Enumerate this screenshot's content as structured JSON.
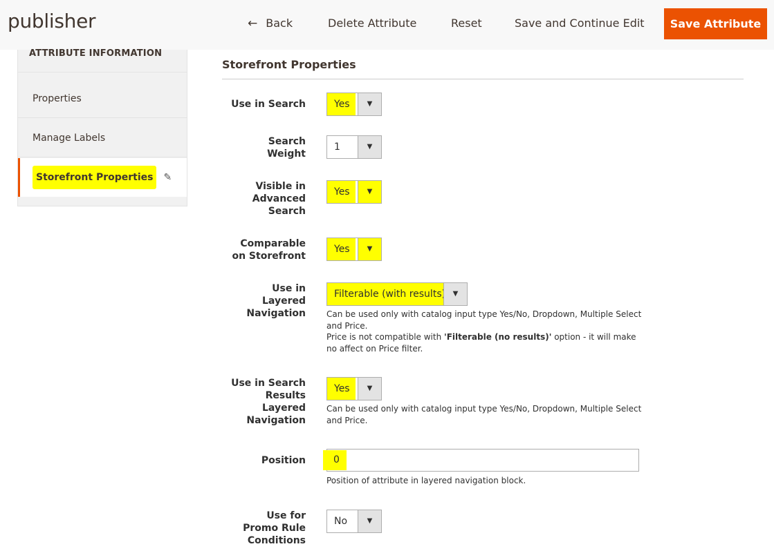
{
  "header": {
    "title": "publisher",
    "back_label": "Back",
    "delete_label": "Delete Attribute",
    "reset_label": "Reset",
    "save_continue_label": "Save and Continue Edit",
    "save_label": "Save Attribute",
    "accent_color": "#eb5202"
  },
  "sidebar": {
    "heading": "ATTRIBUTE INFORMATION",
    "items": [
      {
        "label": "Properties"
      },
      {
        "label": "Manage Labels"
      },
      {
        "label": "Storefront Properties"
      }
    ]
  },
  "section": {
    "title": "Storefront Properties"
  },
  "fields": {
    "use_in_search": {
      "label": "Use in Search",
      "value": "Yes"
    },
    "search_weight": {
      "label_1": "Search",
      "label_2": "Weight",
      "value": "1"
    },
    "visible_advanced": {
      "label_1": "Visible in",
      "label_2": "Advanced",
      "label_3": "Search",
      "value": "Yes"
    },
    "comparable": {
      "label_1": "Comparable",
      "label_2": "on Storefront",
      "value": "Yes"
    },
    "layered_nav": {
      "label_1": "Use in",
      "label_2": "Layered",
      "label_3": "Navigation",
      "value": "Filterable (with results)",
      "note_1": "Can be used only with catalog input type Yes/No, Dropdown, Multiple Select and Price.",
      "note_2_pre": "Price is not compatible with ",
      "note_2_bold": "'Filterable (no results)'",
      "note_2_post": " option - it will make no affect on Price filter."
    },
    "search_results_nav": {
      "label_1": "Use in Search",
      "label_2": "Results",
      "label_3": "Layered",
      "label_4": "Navigation",
      "value": "Yes",
      "note": "Can be used only with catalog input type Yes/No, Dropdown, Multiple Select and Price."
    },
    "position": {
      "label": "Position",
      "value": "0",
      "note": "Position of attribute in layered navigation block."
    },
    "promo_rule": {
      "label_1": "Use for",
      "label_2": "Promo Rule",
      "label_3": "Conditions",
      "value": "No"
    }
  },
  "icons": {
    "back": "arrow-left-icon",
    "edit": "pencil-icon",
    "dropdown": "chevron-down-icon"
  }
}
